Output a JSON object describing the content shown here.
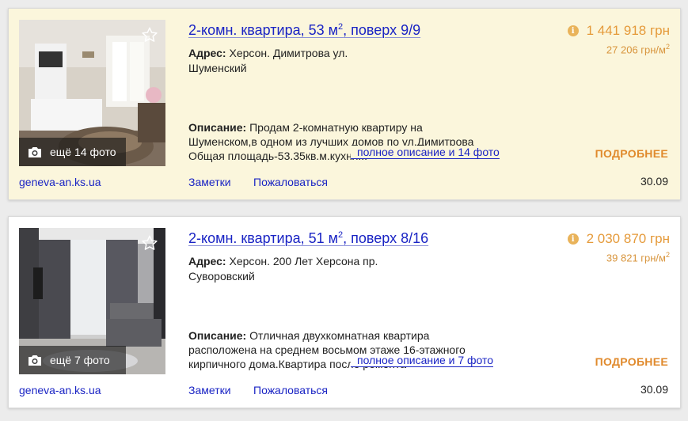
{
  "listings": [
    {
      "title_prefix": "2-комн. квартира, 53 м",
      "title_sup": "2",
      "title_suffix": ", поверх 9/9",
      "price": "1 441 918 грн",
      "price_per_m_prefix": "27 206 грн/м",
      "price_per_m_sup": "2",
      "address_label": "Адрес:",
      "address": "Херсон. Димитрова ул.",
      "district": "Шуменский",
      "description_label": "Описание:",
      "description": "Продам 2-комнатную квартиру на Шуменском,в одном из лучших домов по ул.Димитрова Общая площадь-53.35кв.м.кухня...",
      "full_link": "полное описание и 14 фото",
      "more_photos": "ещё 14 фото",
      "details": "ПОДРОБНЕЕ",
      "source": "geneva-an.ks.ua",
      "notes": "Заметки",
      "complain": "Пожаловаться",
      "date": "30.09",
      "info_icon": "i"
    },
    {
      "title_prefix": "2-комн. квартира, 51 м",
      "title_sup": "2",
      "title_suffix": ", поверх 8/16",
      "price": "2 030 870 грн",
      "price_per_m_prefix": "39 821 грн/м",
      "price_per_m_sup": "2",
      "address_label": "Адрес:",
      "address": "Херсон. 200 Лет Херсона пр.",
      "district": "Суворовский",
      "description_label": "Описание:",
      "description": "Отличная двухкомнатная квартира расположена на среднем восьмом этаже 16-этажного кирпичного дома.Квартира после ремонта",
      "full_link": "полное описание и 7 фото",
      "more_photos": "ещё 7 фото",
      "details": "ПОДРОБНЕЕ",
      "source": "geneva-an.ks.ua",
      "notes": "Заметки",
      "complain": "Пожаловаться",
      "date": "30.09",
      "info_icon": "i"
    }
  ],
  "colors": {
    "link": "#1a24c4",
    "price": "#e59a3a",
    "details": "#e08a2c",
    "highlight_bg": "#fbf6dc"
  }
}
